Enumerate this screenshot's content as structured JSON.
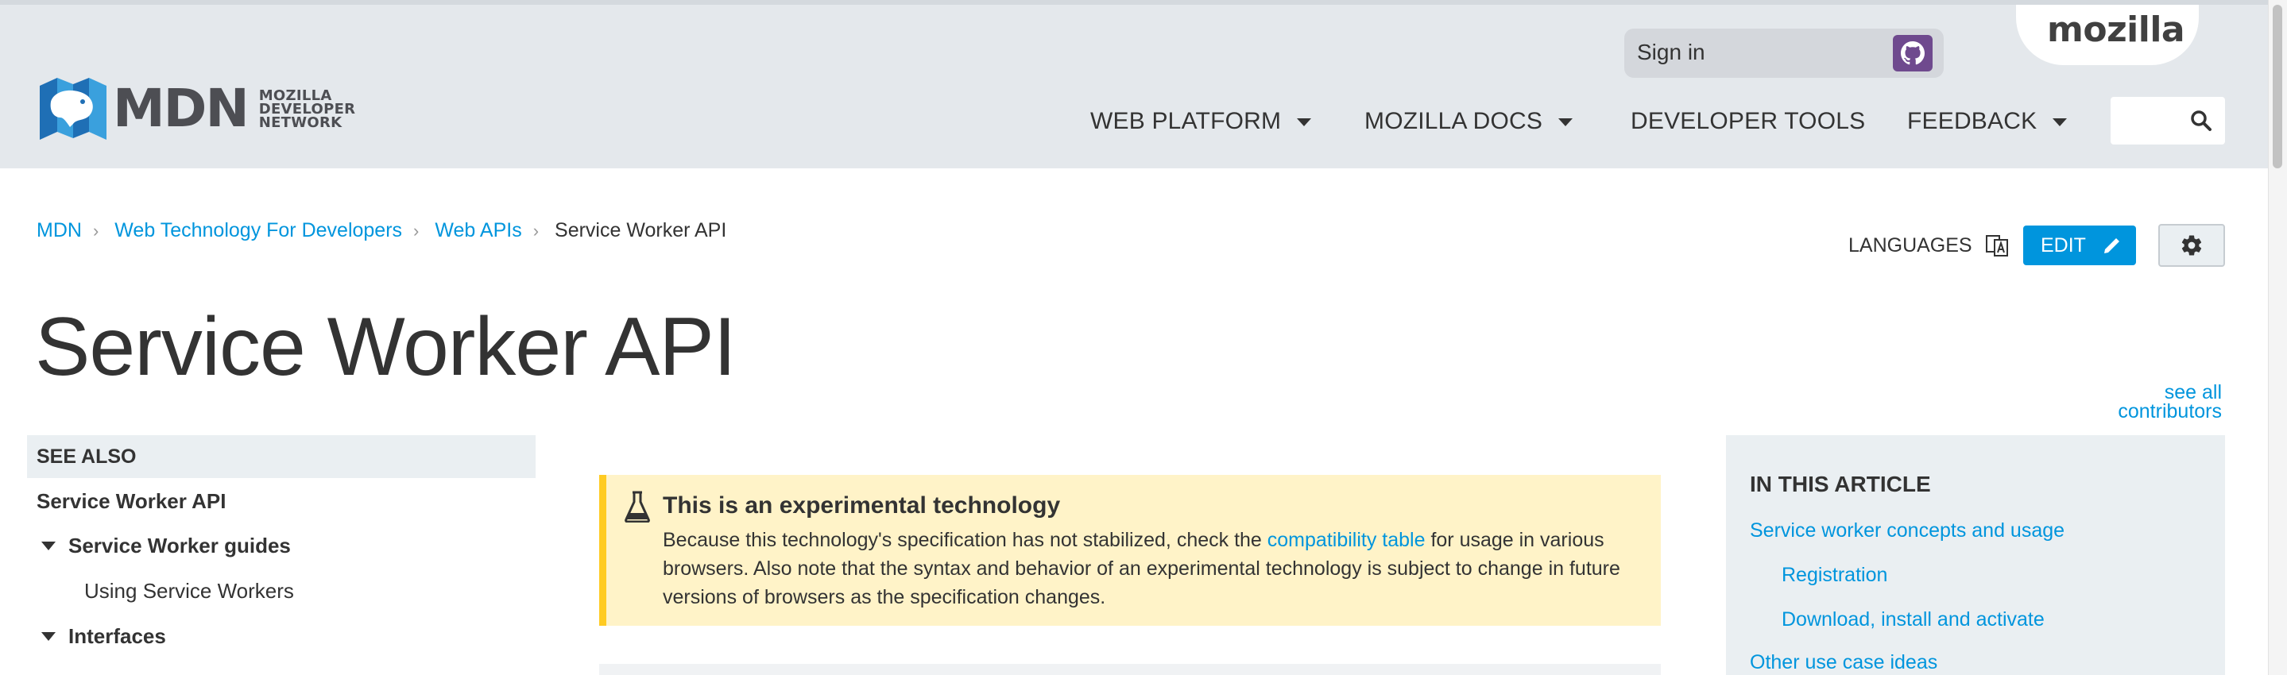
{
  "header": {
    "logo": {
      "word": "MDN",
      "sub": [
        "MOZILLA",
        "DEVELOPER",
        "NETWORK"
      ]
    },
    "mozilla": "mozilla",
    "signin": {
      "label": "Sign in",
      "provider_icon": "github-icon"
    },
    "nav": [
      {
        "label": "WEB PLATFORM",
        "dropdown": true
      },
      {
        "label": "MOZILLA DOCS",
        "dropdown": true
      },
      {
        "label": "DEVELOPER TOOLS",
        "dropdown": false
      },
      {
        "label": "FEEDBACK",
        "dropdown": true
      }
    ],
    "search": {
      "placeholder": "",
      "icon": "search-icon"
    }
  },
  "breadcrumb": {
    "links": [
      "MDN",
      "Web Technology For Developers",
      "Web APIs"
    ],
    "current": "Service Worker API"
  },
  "tools": {
    "languages": "LANGUAGES",
    "edit": "EDIT"
  },
  "page": {
    "title": "Service Worker API",
    "contributors_link": [
      "see all",
      "contributors"
    ]
  },
  "sidebar": {
    "heading": "SEE ALSO",
    "items": [
      {
        "label": "Service Worker API",
        "bold": true
      },
      {
        "label": "Service Worker guides",
        "bold": true,
        "expanded": true
      },
      {
        "label": "Using Service Workers",
        "bold": false
      },
      {
        "label": "Interfaces",
        "bold": true,
        "expanded": true
      }
    ]
  },
  "notice": {
    "title": "This is an experimental technology",
    "body_before": "Because this technology's specification has not stabilized, check the ",
    "link": "compatibility table",
    "body_after": " for usage in various browsers. Also note that the syntax and behavior of an experimental technology is subject to change in future versions of browsers as the specification changes."
  },
  "toc": {
    "heading": "IN THIS ARTICLE",
    "items": [
      {
        "label": "Service worker concepts and usage",
        "level": 1
      },
      {
        "label": "Registration",
        "level": 2
      },
      {
        "label": "Download, install and activate",
        "level": 2
      },
      {
        "label": "Other use case ideas",
        "level": 1
      }
    ]
  },
  "colors": {
    "header_bg": "#e4e8ec",
    "link": "#0095dd",
    "edit_button": "#0095dd",
    "notice_bg": "#fff3c8",
    "notice_border": "#ffcb22",
    "github": "#6f4a8e"
  }
}
